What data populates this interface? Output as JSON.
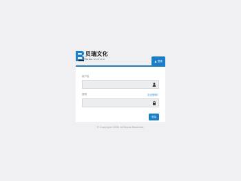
{
  "brand": {
    "name_cn": "贝瑞文化",
    "name_en": "BeiRui Cultural",
    "logo_letter": "B"
  },
  "login_tab": {
    "icon": "user-icon",
    "label": "登录"
  },
  "form": {
    "username_label": "用户名",
    "username_value": "",
    "username_icon": "user-icon",
    "password_label": "密码",
    "password_value": "",
    "password_icon": "lock-icon",
    "forgot_label": "忘记密码?",
    "submit_label": "登录"
  },
  "footer": {
    "copyright": "© Copyright 2018. All Rights Reserved."
  },
  "colors": {
    "accent": "#1a7fc8",
    "background": "#f0f0f2",
    "input_bg": "#ecedf0"
  }
}
